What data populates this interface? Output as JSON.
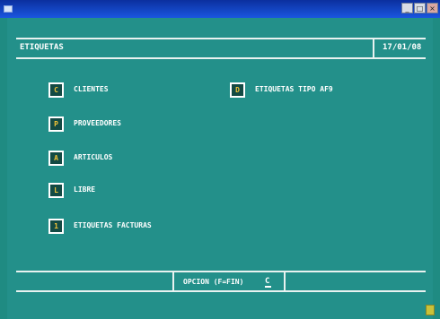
{
  "window": {
    "title": "",
    "minimize_label": "_",
    "maximize_label": "□",
    "close_label": "×"
  },
  "header": {
    "title": "ETIQUETAS",
    "date": "17/01/08"
  },
  "menu": {
    "items": [
      {
        "key": "C",
        "label": "CLIENTES"
      },
      {
        "key": "P",
        "label": "PROVEEDORES"
      },
      {
        "key": "A",
        "label": "ARTICULOS"
      },
      {
        "key": "L",
        "label": "LIBRE"
      },
      {
        "key": "1",
        "label": "ETIQUETAS FACTURAS"
      },
      {
        "key": "D",
        "label": "ETIQUETAS TIPO AF9"
      }
    ]
  },
  "footer": {
    "option_label": "OPCION (F=FIN)",
    "option_value": "C"
  },
  "colors": {
    "background": "#1f8b82",
    "key_text": "#f2c236",
    "text": "#ffffff"
  }
}
